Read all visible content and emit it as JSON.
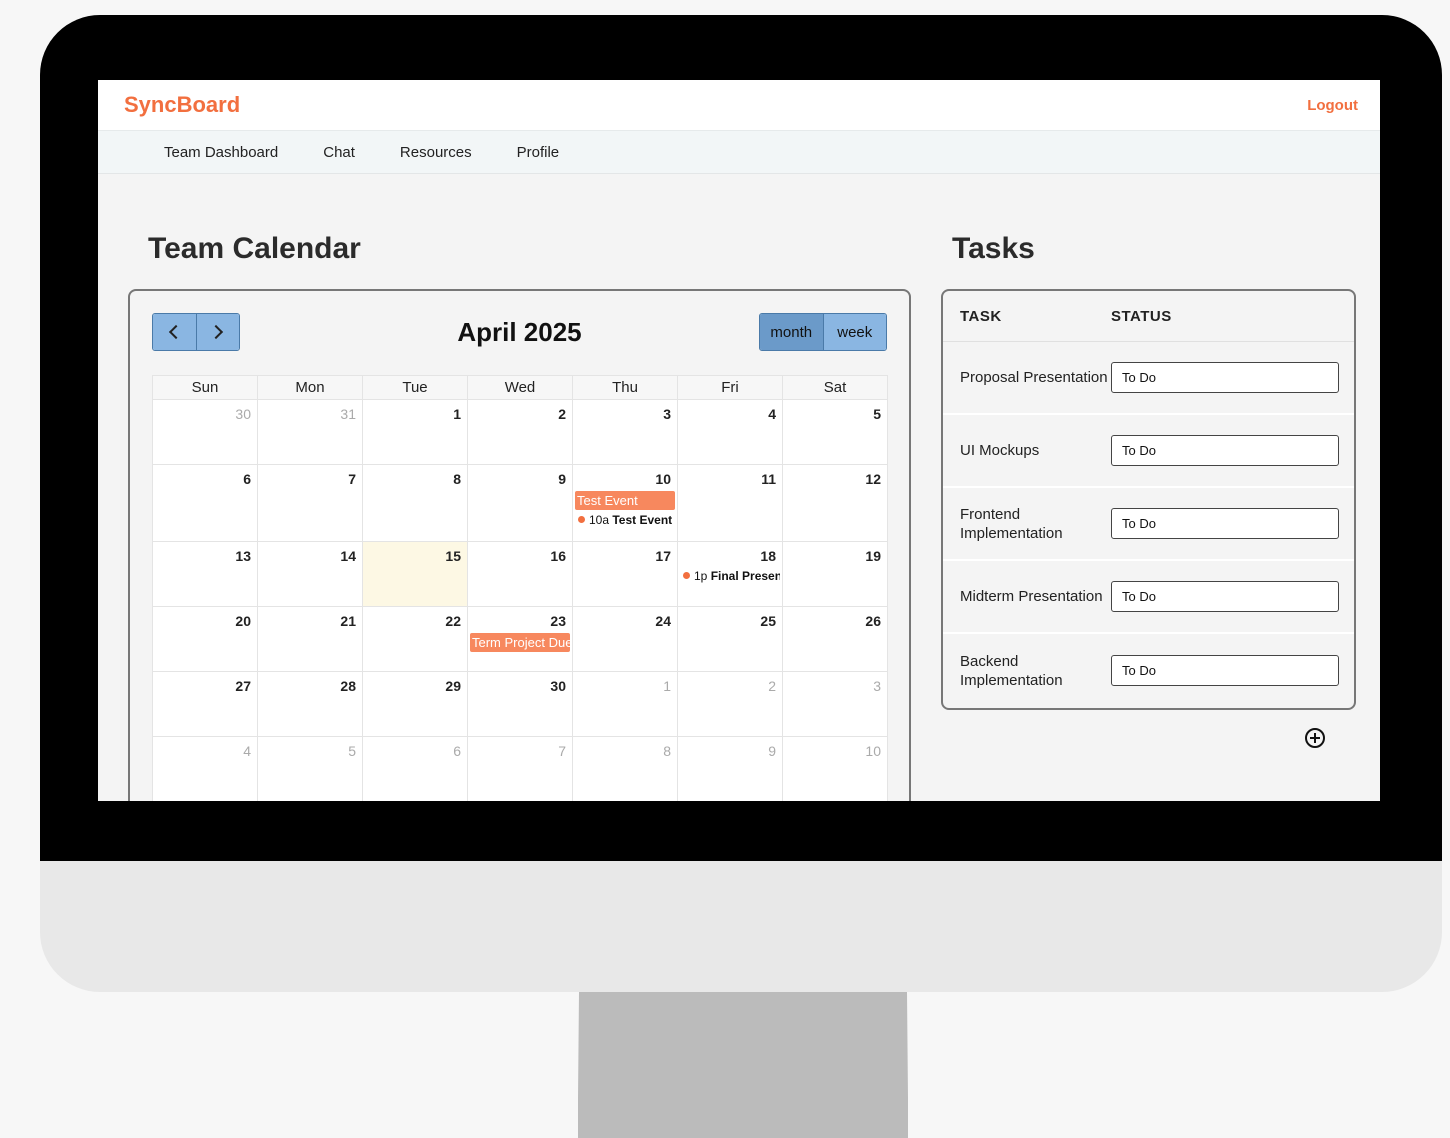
{
  "app": {
    "brand": "SyncBoard",
    "logout_label": "Logout",
    "brand_color": "#f26f3f"
  },
  "nav": {
    "items": [
      "Team Dashboard",
      "Chat",
      "Resources",
      "Profile"
    ]
  },
  "calendar": {
    "heading": "Team Calendar",
    "month_title": "April 2025",
    "prev_icon": "chevron-left-icon",
    "next_icon": "chevron-right-icon",
    "view_month": "month",
    "view_week": "week",
    "days_of_week": [
      "Sun",
      "Mon",
      "Tue",
      "Wed",
      "Thu",
      "Fri",
      "Sat"
    ],
    "weeks": [
      [
        {
          "d": "30",
          "o": true
        },
        {
          "d": "31",
          "o": true
        },
        {
          "d": "1"
        },
        {
          "d": "2"
        },
        {
          "d": "3"
        },
        {
          "d": "4"
        },
        {
          "d": "5"
        }
      ],
      [
        {
          "d": "6"
        },
        {
          "d": "7"
        },
        {
          "d": "8"
        },
        {
          "d": "9"
        },
        {
          "d": "10"
        },
        {
          "d": "11"
        },
        {
          "d": "12"
        }
      ],
      [
        {
          "d": "13"
        },
        {
          "d": "14"
        },
        {
          "d": "15",
          "today": true
        },
        {
          "d": "16"
        },
        {
          "d": "17"
        },
        {
          "d": "18"
        },
        {
          "d": "19"
        }
      ],
      [
        {
          "d": "20"
        },
        {
          "d": "21"
        },
        {
          "d": "22"
        },
        {
          "d": "23"
        },
        {
          "d": "24"
        },
        {
          "d": "25"
        },
        {
          "d": "26"
        }
      ],
      [
        {
          "d": "27"
        },
        {
          "d": "28"
        },
        {
          "d": "29"
        },
        {
          "d": "30"
        },
        {
          "d": "1",
          "o": true
        },
        {
          "d": "2",
          "o": true
        },
        {
          "d": "3",
          "o": true
        }
      ],
      [
        {
          "d": "4",
          "o": true
        },
        {
          "d": "5",
          "o": true
        },
        {
          "d": "6",
          "o": true
        },
        {
          "d": "7",
          "o": true
        },
        {
          "d": "8",
          "o": true
        },
        {
          "d": "9",
          "o": true
        },
        {
          "d": "10",
          "o": true
        }
      ]
    ],
    "events": [
      {
        "week": 1,
        "day": 4,
        "type": "bar",
        "label": "Test Event"
      },
      {
        "week": 1,
        "day": 4,
        "type": "dot",
        "time": "10a",
        "label": "Test Event"
      },
      {
        "week": 2,
        "day": 5,
        "type": "dot",
        "time": "1p",
        "label": "Final Presentation"
      },
      {
        "week": 3,
        "day": 3,
        "type": "bar",
        "label": "Term Project Due"
      }
    ],
    "event_color": "#f7885e",
    "today_color": "#fdf8e4"
  },
  "tasks": {
    "heading": "Tasks",
    "col_task": "TASK",
    "col_status": "STATUS",
    "rows": [
      {
        "name": "Proposal Presentation",
        "status": "To Do"
      },
      {
        "name": "UI Mockups",
        "status": "To Do"
      },
      {
        "name": "Frontend Implementation",
        "status": "To Do"
      },
      {
        "name": "Midterm Presentation",
        "status": "To Do"
      },
      {
        "name": "Backend Implementation",
        "status": "To Do"
      }
    ],
    "add_icon": "plus-circle-icon"
  }
}
